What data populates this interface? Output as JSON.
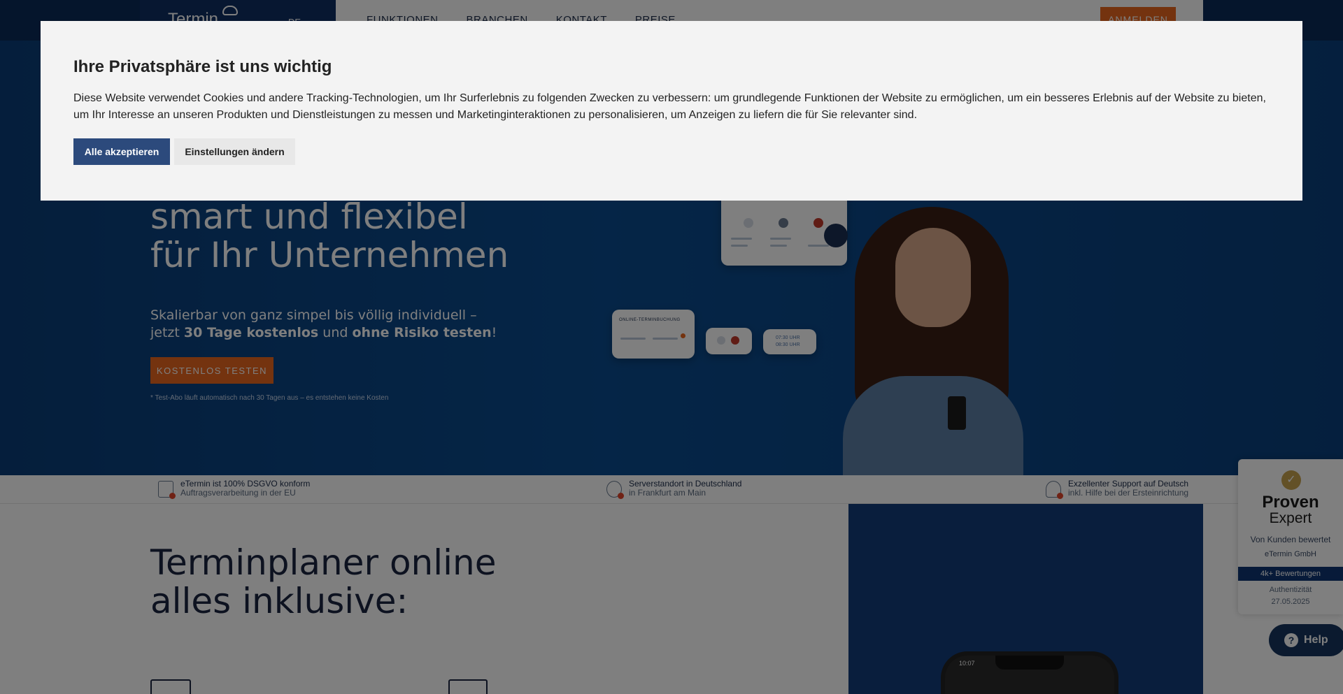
{
  "header": {
    "logo_text": "Termin",
    "lang_label": "DE",
    "nav": [
      "FUNKTIONEN",
      "BRANCHEN",
      "KONTAKT",
      "PREISE"
    ],
    "login_label": "ANMELDEN"
  },
  "hero": {
    "title_line1": "smart und flexibel",
    "title_line2": "für Ihr Unternehmen",
    "sub_line1": "Skalierbar von ganz simpel bis völlig individuell –",
    "sub_pre": "jetzt ",
    "sub_bold1": "30 Tage kostenlos",
    "sub_mid": " und ",
    "sub_bold2": "ohne Risiko testen",
    "sub_end": "!",
    "cta_label": "KOSTENLOS TESTEN",
    "note": "* Test-Abo läuft automatisch nach 30 Tagen aus – es entstehen keine Kosten",
    "card_online_title": "ONLINE-TERMINBUCHUNG",
    "card_time_line1": "07:30 UHR",
    "card_time_line2": "08:30 UHR"
  },
  "features": [
    {
      "title": "eTermin ist 100% DSGVO konform",
      "sub": "Auftragsverarbeitung in der EU"
    },
    {
      "title": "Serverstandort in Deutschland",
      "sub": "in Frankfurt am Main"
    },
    {
      "title": "Exzellenter Support auf Deutsch",
      "sub": "inkl. Hilfe bei der Ersteinrichtung"
    }
  ],
  "lower": {
    "title_line1": "Terminplaner online",
    "title_line2": "alles inklusive:",
    "phone_time": "10:07"
  },
  "proven_expert": {
    "brand1": "Proven",
    "brand2": "Expert",
    "question": "Von Kunden bewertet",
    "company": "eTermin GmbH",
    "badge": "4k+ Bewertungen",
    "auth": "Authentizität",
    "date": "27.05.2025"
  },
  "help": {
    "label": "Help"
  },
  "cookie_modal": {
    "title": "Ihre Privatsphäre ist uns wichtig",
    "text": "Diese Website verwendet Cookies und andere Tracking-Technologien, um Ihr Surferlebnis zu folgenden Zwecken zu verbessern: um grundlegende Funktionen der Website zu ermöglichen, um ein besseres Erlebnis auf der Website zu bieten, um Ihr Interesse an unseren Produkten und Dienstleistungen zu messen und Marketinginteraktionen zu personalisieren, um Anzeigen zu liefern die für Sie relevanter sind.",
    "accept_label": "Alle akzeptieren",
    "settings_label": "Einstellungen ändern"
  },
  "colors": {
    "accent": "#e8661f",
    "primary": "#2c4a7c",
    "overlay": "rgba(0,0,0,0.5)"
  }
}
